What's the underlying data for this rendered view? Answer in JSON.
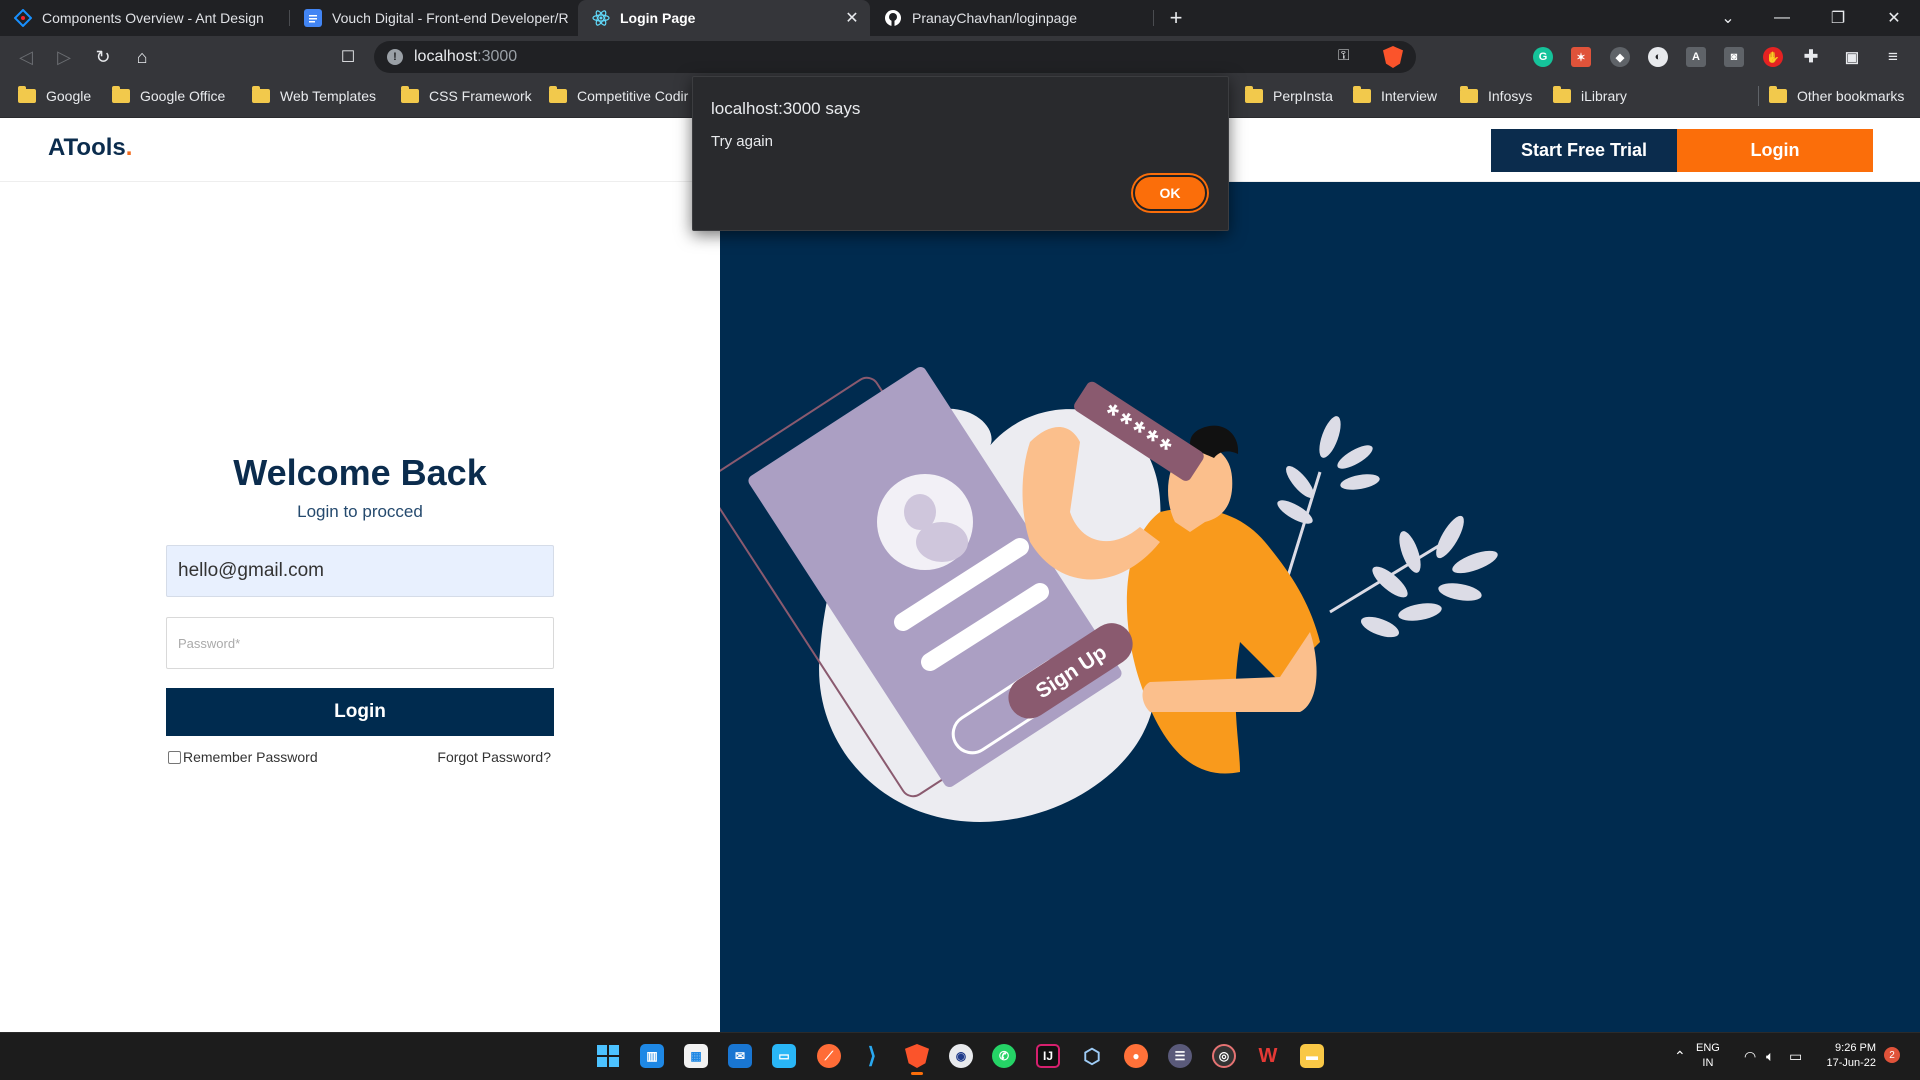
{
  "browser": {
    "tabs": [
      {
        "title": "Components Overview - Ant Design",
        "icon": "ant-design-logo-icon"
      },
      {
        "title": "Vouch Digital - Front-end Developer/R",
        "icon": "google-docs-icon"
      },
      {
        "title": "Login Page",
        "icon": "react-logo-icon",
        "active": true
      },
      {
        "title": "PranayChavhan/loginpage",
        "icon": "github-icon"
      }
    ],
    "address": {
      "host": "localhost",
      "port": ":3000"
    },
    "bookmarks": [
      "Google",
      "Google Office",
      "Web Templates",
      "CSS Framework",
      "Competitive Codir",
      "PerpInsta",
      "Interview",
      "Infosys",
      "iLibrary",
      "Other bookmarks"
    ]
  },
  "app": {
    "brand": "ATools",
    "brand_dot": ".",
    "nav": {
      "trial_label": "Start Free Trial",
      "login_label": "Login"
    },
    "form": {
      "title": "Welcome Back",
      "subtitle": "Login to procced",
      "email_value": "hello@gmail.com",
      "password_placeholder": "Password*",
      "login_label": "Login",
      "remember_label": "Remember Password",
      "forgot_label": "Forgot Password?"
    },
    "illustration": {
      "password_mask": "*****",
      "button_text": "Sign Up"
    },
    "colors": {
      "navy": "#002b4f",
      "orange": "#fb6e0a"
    }
  },
  "dialog": {
    "title": "localhost:3000 says",
    "message": "Try again",
    "ok_label": "OK"
  },
  "taskbar": {
    "apps": [
      "windows-start-icon",
      "widgets-icon",
      "store-icon",
      "mail-icon",
      "desktop-icon",
      "postman-icon",
      "vscode-icon",
      "brave-icon",
      "app-icon",
      "whatsapp-icon",
      "intellij-icon",
      "virtualbox-icon",
      "firefox-icon",
      "app-icon",
      "app-icon",
      "wps-icon",
      "file-explorer-icon"
    ],
    "lang_line1": "ENG",
    "lang_line2": "IN",
    "time": "9:26 PM",
    "date": "17-Jun-22",
    "notifications": "2"
  }
}
